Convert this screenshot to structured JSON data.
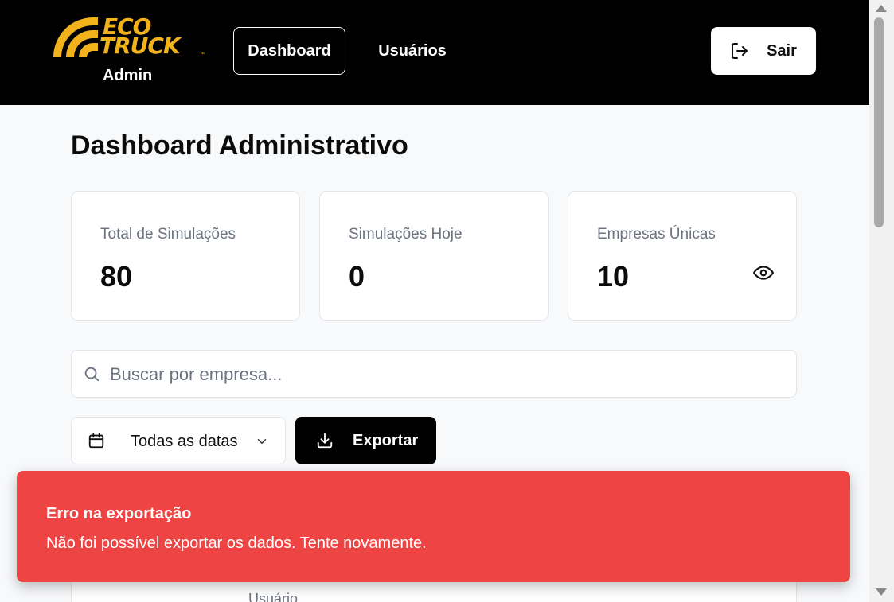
{
  "header": {
    "brand_line1": "ECO",
    "brand_line2": "TRUCK",
    "brand_tm": "™",
    "role": "Admin",
    "nav": [
      {
        "label": "Dashboard",
        "active": true
      },
      {
        "label": "Usuários",
        "active": false
      }
    ],
    "logout_label": "Sair",
    "brand_color": "#f2b21c"
  },
  "main": {
    "title": "Dashboard Administrativo",
    "stats": [
      {
        "label": "Total de Simulações",
        "value": "80"
      },
      {
        "label": "Simulações Hoje",
        "value": "0"
      },
      {
        "label": "Empresas Únicas",
        "value": "10"
      }
    ],
    "search": {
      "placeholder": "Buscar por empresa...",
      "value": ""
    },
    "date_filter": {
      "selected": "Todas as datas"
    },
    "export_label": "Exportar",
    "table": {
      "column_partial": "Usuário"
    }
  },
  "toast": {
    "title": "Erro na exportação",
    "message": "Não foi possível exportar os dados. Tente novamente.",
    "color": "#ef4444"
  }
}
